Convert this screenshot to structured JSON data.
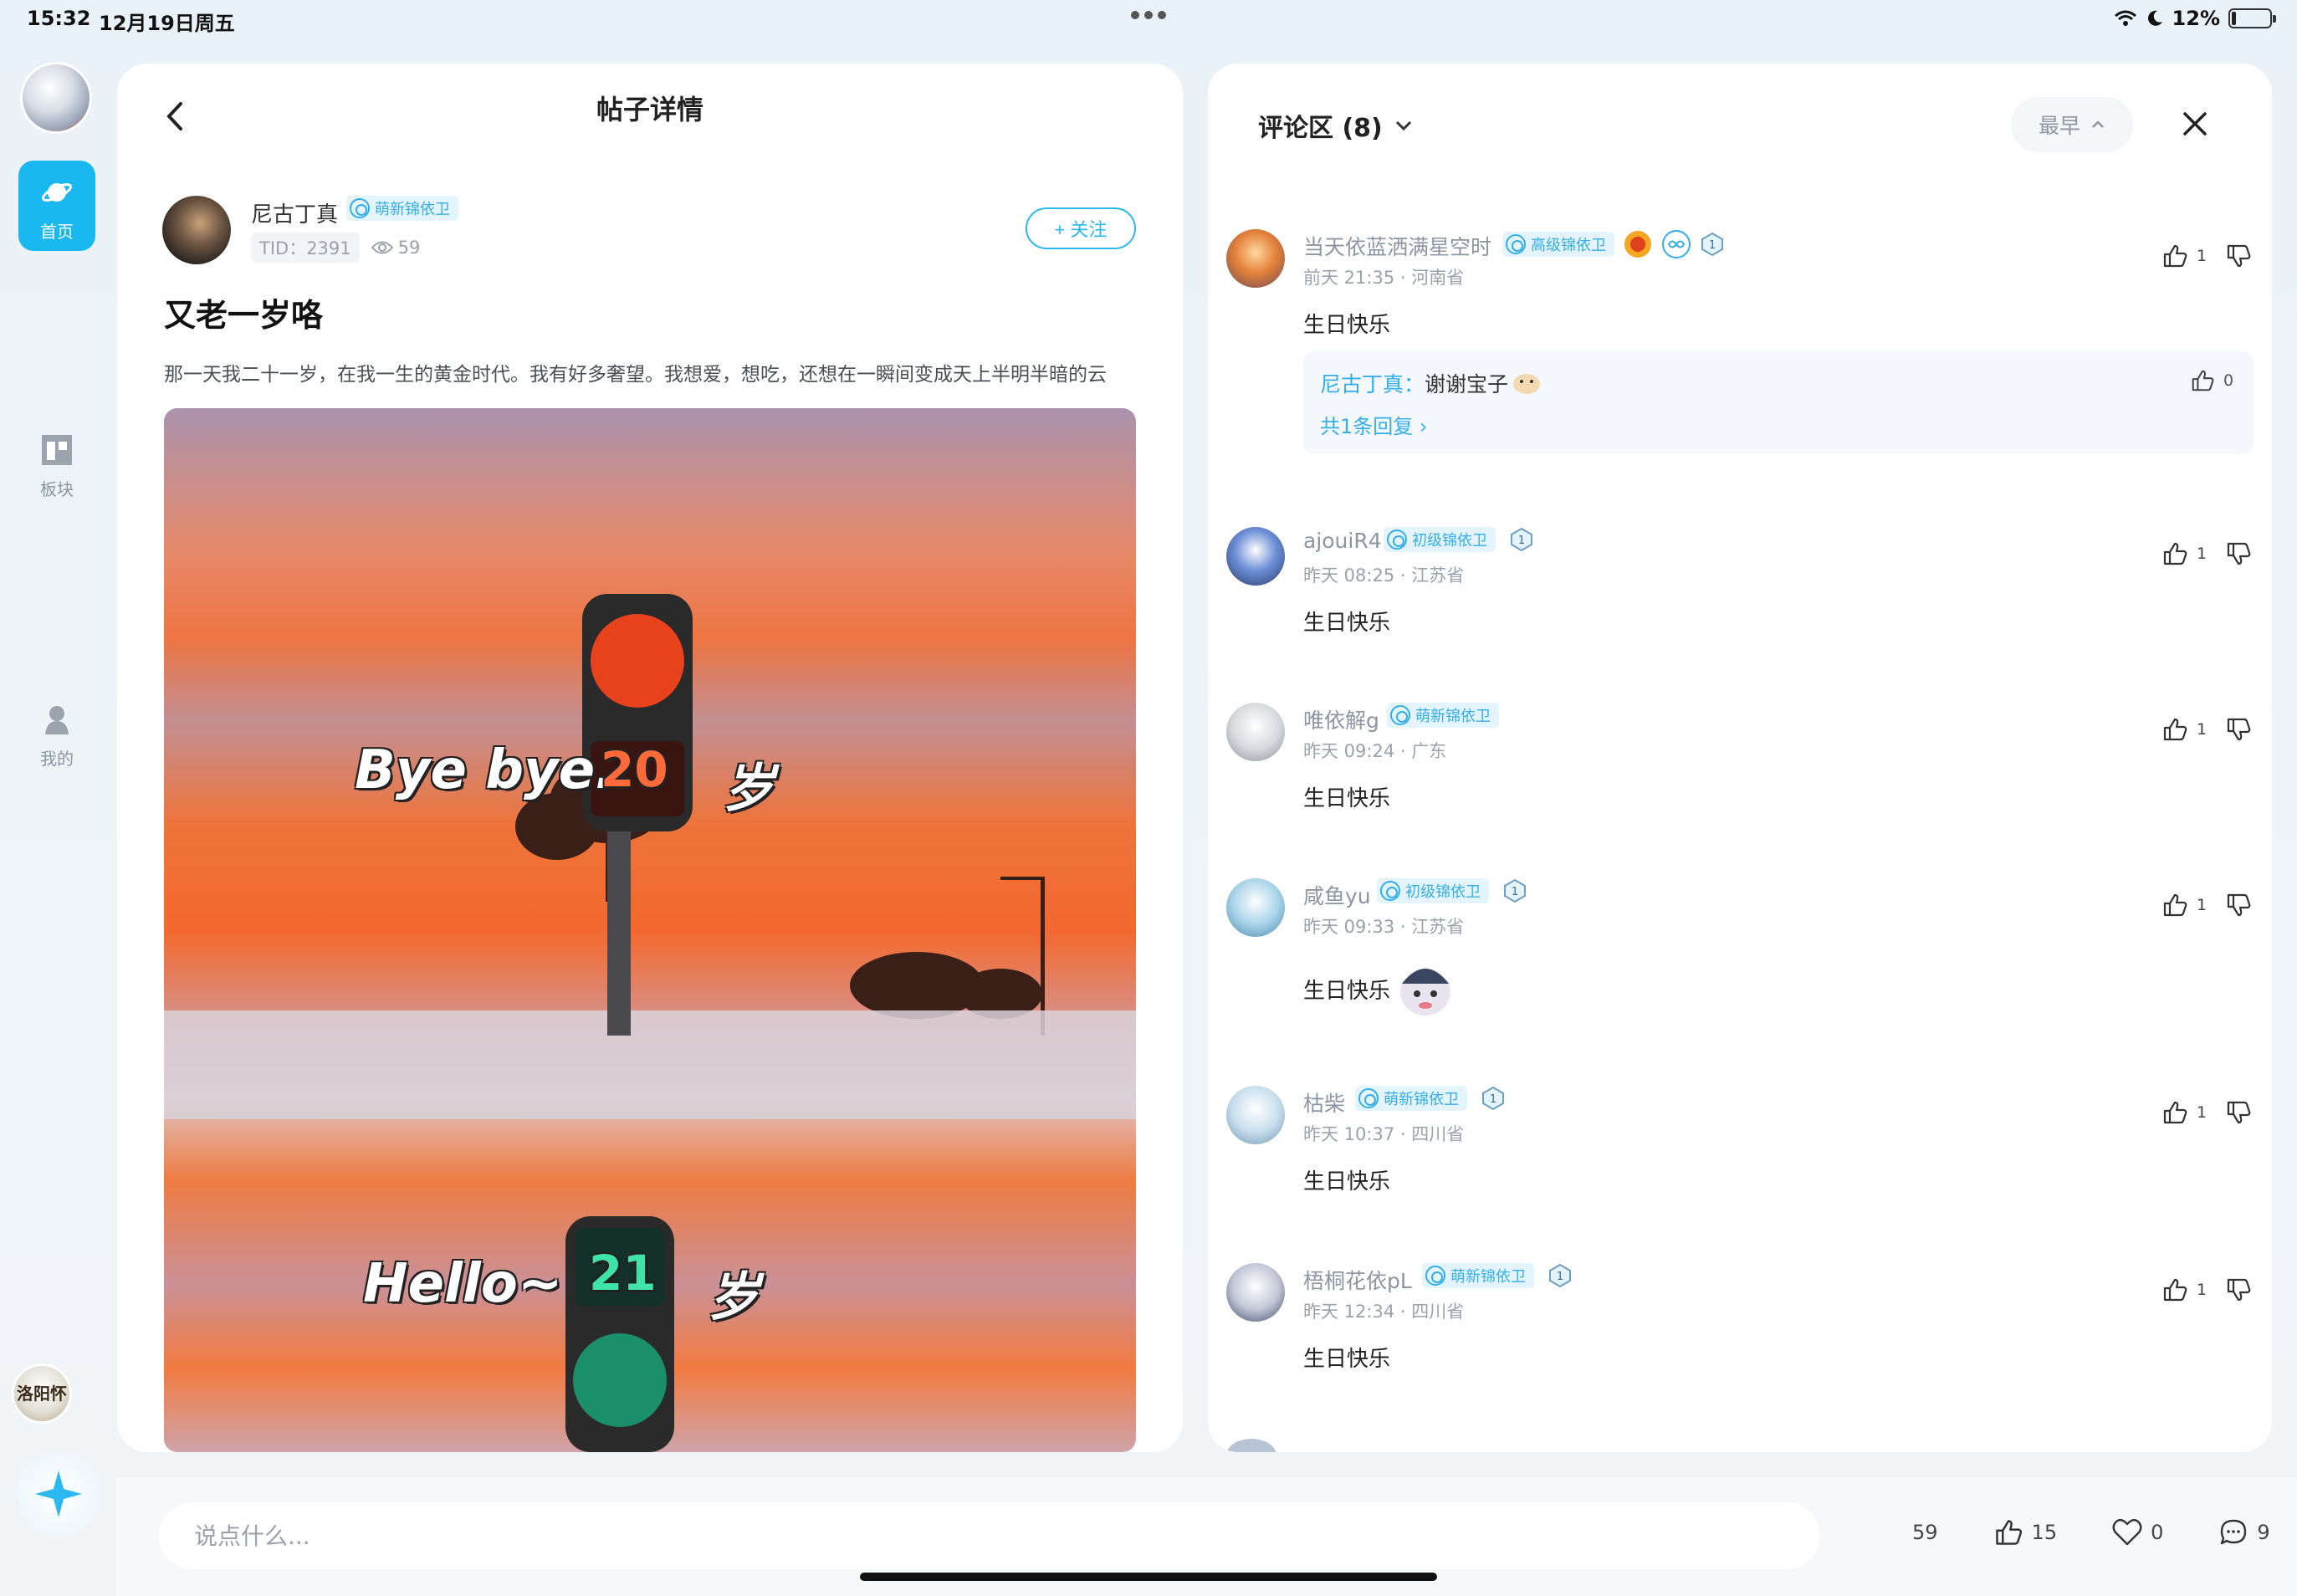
{
  "status_bar": {
    "time": "15:32",
    "date": "12月19日周五",
    "battery": "12%",
    "battery_level": 0.12
  },
  "rail": {
    "items": [
      {
        "label": "首页",
        "icon": "planet-icon",
        "active": true
      },
      {
        "label": "板块",
        "icon": "board-icon",
        "active": false
      },
      {
        "label": "我的",
        "icon": "profile-icon",
        "active": false
      }
    ],
    "mini_avatar_text": "洛阳怀"
  },
  "post": {
    "page_title": "帖子详情",
    "author": {
      "name": "尼古丁真",
      "badge": "萌新锦依卫",
      "tid": "TID：2391",
      "views": "59"
    },
    "follow_label": "+ 关注",
    "title": "又老一岁咯",
    "body": "那一天我二十一岁，在我一生的黄金时代。我有好多奢望。我想爱，想吃，还想在一瞬间变成天上半明半暗的云",
    "image": {
      "text_top": "Bye bye.",
      "number_top": "20",
      "suffix_top": "岁",
      "text_bottom": "Hello~",
      "number_bottom": "21",
      "suffix_bottom": "岁"
    }
  },
  "comments_panel": {
    "title": "评论区 (8)",
    "sort_label": "最早",
    "comments": [
      {
        "name": "当天依蓝洒满星空时",
        "badge": "高级锦依卫",
        "level": "1",
        "meta": "前天 21:35 · 河南省",
        "text": "生日快乐",
        "likes": "1",
        "reply": {
          "author": "尼古丁真：",
          "text": "谢谢宝子",
          "likes": "0",
          "more": "共1条回复 ›"
        }
      },
      {
        "name": "ajouiR4",
        "badge": "初级锦依卫",
        "level": "1",
        "meta": "昨天 08:25 · 江苏省",
        "text": "生日快乐",
        "likes": "1"
      },
      {
        "name": "唯依解g",
        "badge": "萌新锦依卫",
        "meta": "昨天 09:24 · 广东",
        "text": "生日快乐",
        "likes": "1"
      },
      {
        "name": "咸鱼yu",
        "badge": "初级锦依卫",
        "level": "1",
        "meta": "昨天 09:33 · 江苏省",
        "text": "生日快乐",
        "likes": "1"
      },
      {
        "name": "枯柴",
        "badge": "萌新锦依卫",
        "level": "1",
        "meta": "昨天 10:37 · 四川省",
        "text": "生日快乐",
        "likes": "1"
      },
      {
        "name": "梧桐花依pL",
        "badge": "萌新锦依卫",
        "level": "1",
        "meta": "昨天 12:34 · 四川省",
        "text": "生日快乐",
        "likes": "1"
      }
    ]
  },
  "bottom_bar": {
    "placeholder": "说点什么...",
    "views": "59",
    "likes": "15",
    "favorites": "0",
    "comments": "9"
  },
  "colors": {
    "accent": "#1ab8f0",
    "badge_bg": "#e4f4fd",
    "badge_text": "#34aee8"
  }
}
